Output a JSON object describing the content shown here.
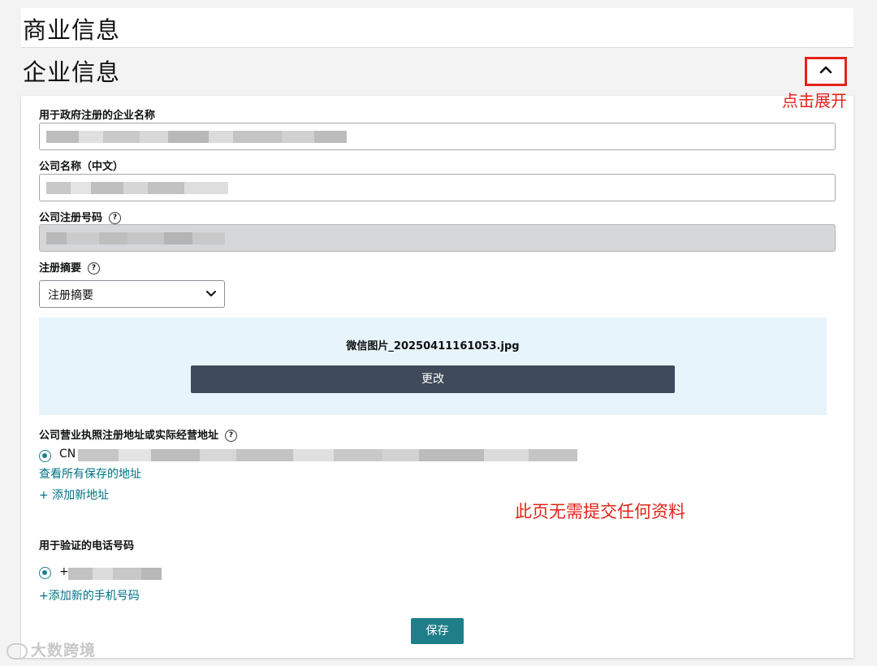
{
  "sections": {
    "business_info_title": "商业信息",
    "company_info_title": "企业信息"
  },
  "annotations": {
    "expand_hint": "点击展开",
    "no_submit_note": "此页无需提交任何资料"
  },
  "form": {
    "gov_registered_name_label": "用于政府注册的企业名称",
    "company_name_cn_label": "公司名称（中文）",
    "registration_number_label": "公司注册号码",
    "registration_summary_label": "注册摘要",
    "registration_summary_value": "注册摘要",
    "uploaded_filename": "微信图片_20250411161053.jpg",
    "change_button": "更改",
    "address_label": "公司营业执照注册地址或实际经营地址",
    "address_prefix": "CN",
    "view_saved_addresses": "查看所有保存的地址",
    "add_new_address": "+ 添加新地址",
    "phone_label": "用于验证的电话号码",
    "phone_prefix": "+",
    "add_new_phone": "+添加新的手机号码",
    "save_button": "保存"
  },
  "icons": {
    "collapse": "chevron-up-icon",
    "select": "chevron-down-icon",
    "help": "question-circle-icon"
  },
  "colors": {
    "annotation_red": "#e2231a",
    "teal": "#1e7f8a",
    "link": "#007185",
    "dark_button": "#3f4a5a",
    "upload_bg": "#e8f4fb"
  },
  "watermark": "大数跨境"
}
